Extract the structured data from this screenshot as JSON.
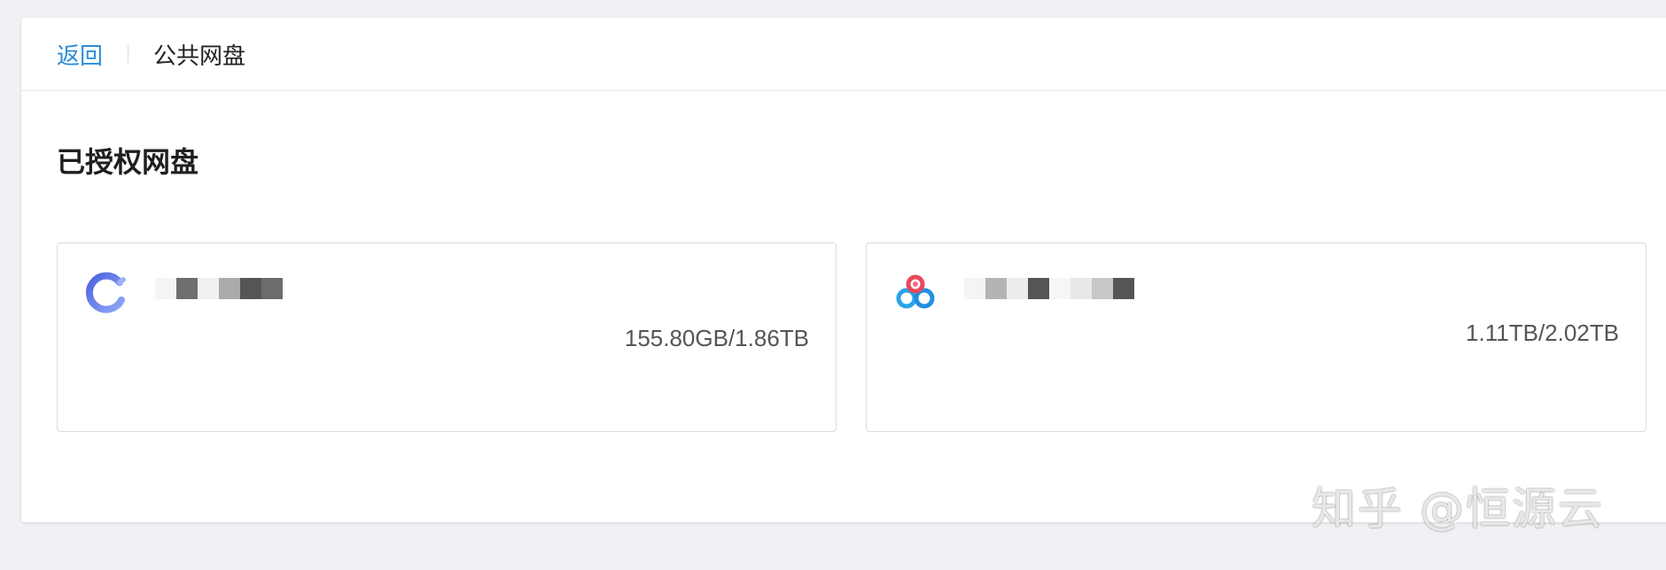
{
  "header": {
    "back_label": "返回",
    "title": "公共网盘"
  },
  "section": {
    "title": "已授权网盘"
  },
  "drives": [
    {
      "icon": "drive-c-ring-icon",
      "name_blurred": true,
      "usage": "155.80GB/1.86TB",
      "accent": "#5b7ae8"
    },
    {
      "icon": "baidu-cloud-icon",
      "name_blurred": true,
      "usage": "1.11TB/2.02TB",
      "accent": "#2aa3e8"
    }
  ],
  "watermark": "知乎 @恒源云"
}
